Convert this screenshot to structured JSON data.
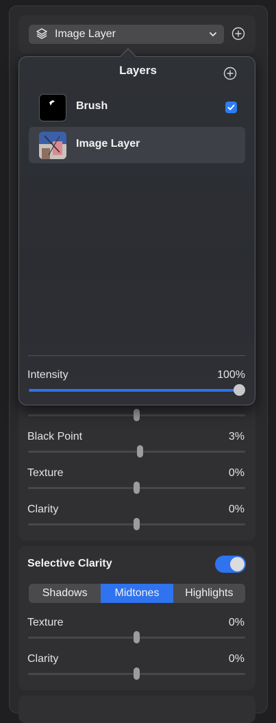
{
  "header": {
    "layer_select_label": "Image Layer"
  },
  "popover": {
    "title": "Layers",
    "layers": [
      {
        "name": "Brush",
        "checked": true,
        "selected": false
      },
      {
        "name": "Image Layer",
        "checked": false,
        "selected": true
      }
    ],
    "intensity_label": "Intensity",
    "intensity_value": "100%",
    "intensity_level": 1.0
  },
  "adjustments": {
    "black_point_label": "Black Point",
    "black_point_value": "3%",
    "texture_label": "Texture",
    "texture_value": "0%",
    "clarity_label": "Clarity",
    "clarity_value": "0%"
  },
  "selective_clarity": {
    "title": "Selective Clarity",
    "enabled": true,
    "segments": [
      "Shadows",
      "Midtones",
      "Highlights"
    ],
    "active_segment": "Midtones",
    "texture_label": "Texture",
    "texture_value": "0%",
    "clarity_label": "Clarity",
    "clarity_value": "0%"
  },
  "colors": {
    "accent": "#2f73ef",
    "panel": "#303033",
    "background": "#1f1f21"
  },
  "icons": {
    "layer_stack": "layers-stack-icon",
    "chevron": "chevron-down-icon",
    "add": "plus-circle-icon",
    "checkbox": "checkmark-icon"
  }
}
